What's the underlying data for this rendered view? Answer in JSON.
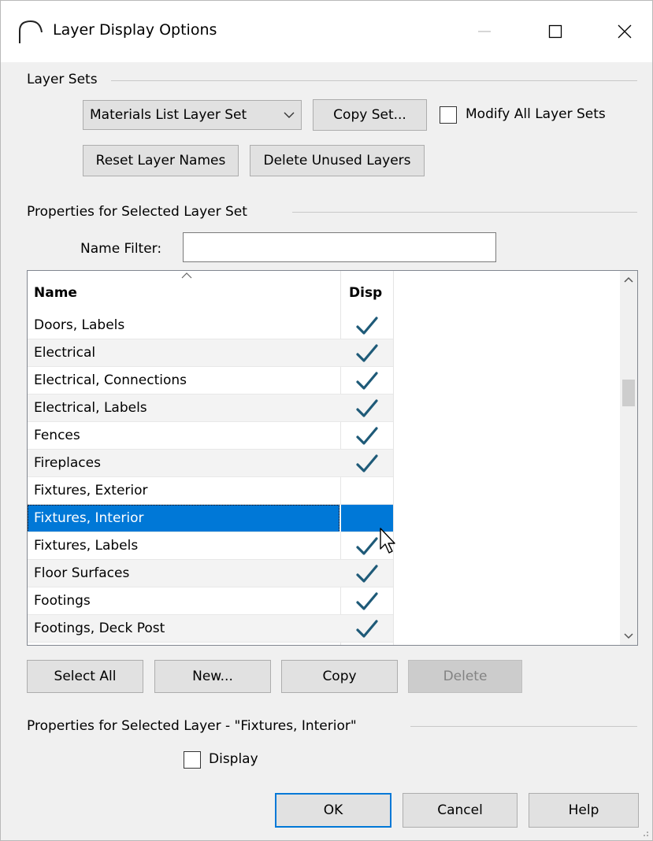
{
  "window": {
    "title": "Layer Display Options",
    "minimize_glyph": "—",
    "maximize_glyph": "☐",
    "close_glyph": "✕"
  },
  "layer_sets": {
    "group_label": "Layer Sets",
    "selected_set": "Materials List Layer Set",
    "copy_set_label": "Copy Set...",
    "modify_all_label": "Modify All Layer Sets",
    "modify_all_checked": false,
    "reset_names_label": "Reset Layer Names",
    "delete_unused_label": "Delete Unused Layers"
  },
  "set_properties": {
    "group_label": "Properties for Selected Layer Set",
    "name_filter_label": "Name Filter:",
    "name_filter_value": ""
  },
  "layer_list": {
    "columns": [
      "Name",
      "Disp"
    ],
    "rows": [
      {
        "name": "Doors, Labels",
        "display": true
      },
      {
        "name": "Electrical",
        "display": true
      },
      {
        "name": "Electrical, Connections",
        "display": true
      },
      {
        "name": "Electrical, Labels",
        "display": true
      },
      {
        "name": "Fences",
        "display": true
      },
      {
        "name": "Fireplaces",
        "display": true
      },
      {
        "name": "Fixtures, Exterior",
        "display": false
      },
      {
        "name": "Fixtures, Interior",
        "display": false,
        "selected": true
      },
      {
        "name": "Fixtures, Labels",
        "display": true
      },
      {
        "name": "Floor Surfaces",
        "display": true
      },
      {
        "name": "Footings",
        "display": true
      },
      {
        "name": "Footings, Deck Post",
        "display": true
      }
    ],
    "check_color": "#1e5a78",
    "selection_color": "#0078d7"
  },
  "list_actions": {
    "select_all_label": "Select All",
    "new_label": "New...",
    "copy_label": "Copy",
    "delete_label": "Delete"
  },
  "layer_properties": {
    "group_label": "Properties for Selected Layer - \"Fixtures, Interior\"",
    "display_label": "Display",
    "display_checked": false
  },
  "footer": {
    "ok_label": "OK",
    "cancel_label": "Cancel",
    "help_label": "Help"
  }
}
